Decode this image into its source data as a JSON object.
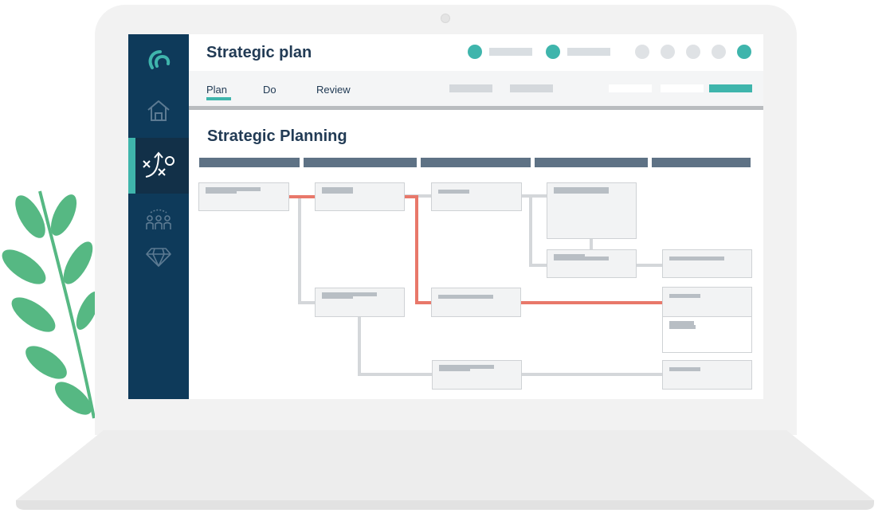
{
  "app": {
    "logo_icon": "swirl-logo-icon",
    "title": "Strategic plan"
  },
  "sidebar": {
    "items": [
      {
        "icon": "home-icon",
        "active": false
      },
      {
        "icon": "strategy-play-icon",
        "active": true
      },
      {
        "icon": "people-group-icon",
        "active": false
      },
      {
        "icon": "diamond-icon",
        "active": false
      }
    ]
  },
  "tabs": [
    {
      "label": "Plan",
      "active": true
    },
    {
      "label": "Do",
      "active": false
    },
    {
      "label": "Review",
      "active": false
    }
  ],
  "main": {
    "section_title": "Strategic Planning"
  },
  "colors": {
    "sidebar": "#0e3a5a",
    "accent": "#3fb5ac",
    "heading": "#223b55",
    "critical_path": "#e8786a",
    "connector": "#d4d7da",
    "column_header": "#5e7285"
  }
}
